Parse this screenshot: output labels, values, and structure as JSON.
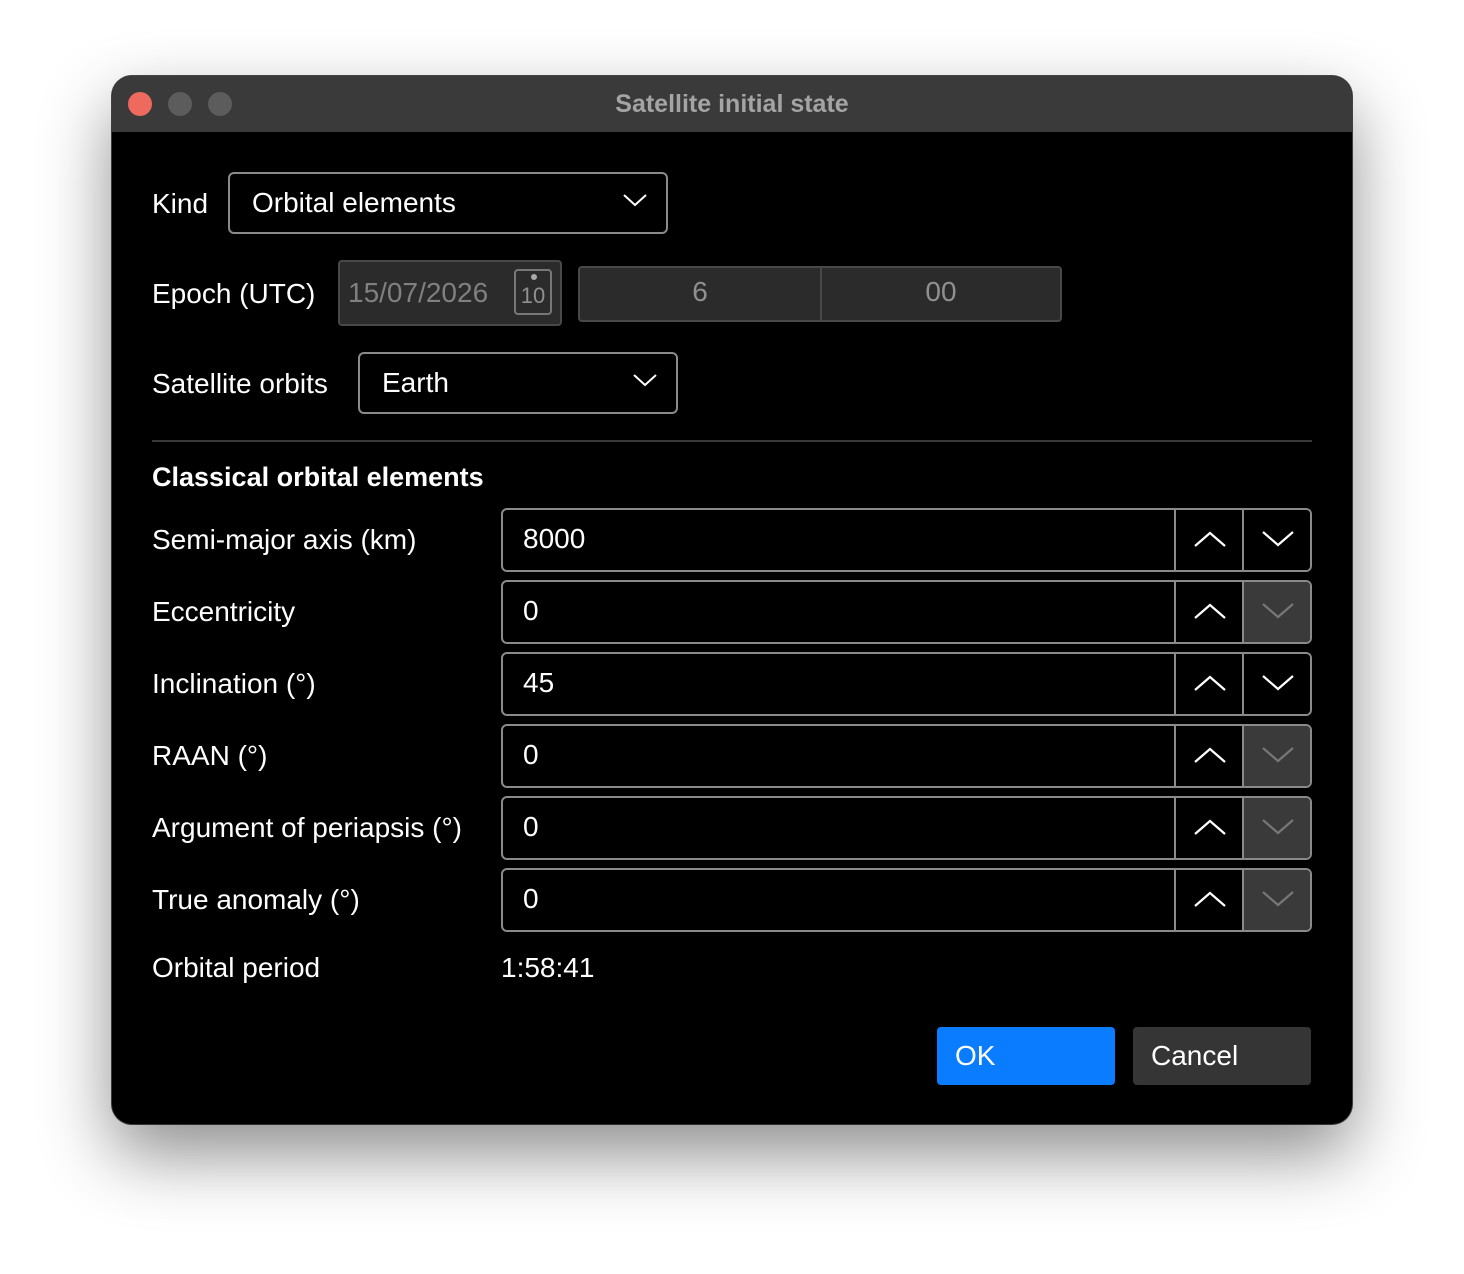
{
  "window": {
    "title": "Satellite initial state"
  },
  "kind": {
    "label": "Kind",
    "value": "Orbital elements"
  },
  "epoch": {
    "label": "Epoch (UTC)",
    "date": "15/07/2026",
    "calendar_day": "10",
    "hour": "6",
    "minute": "00"
  },
  "orbits": {
    "label": "Satellite orbits",
    "value": "Earth"
  },
  "section_title": "Classical orbital elements",
  "fields": [
    {
      "label": "Semi-major axis (km)",
      "value": "8000",
      "down_enabled": true
    },
    {
      "label": "Eccentricity",
      "value": "0",
      "down_enabled": false
    },
    {
      "label": "Inclination (°)",
      "value": "45",
      "down_enabled": true
    },
    {
      "label": "RAAN (°)",
      "value": "0",
      "down_enabled": false
    },
    {
      "label": "Argument of periapsis (°)",
      "value": "0",
      "down_enabled": false
    },
    {
      "label": "True anomaly (°)",
      "value": "0",
      "down_enabled": false
    }
  ],
  "period": {
    "label": "Orbital period",
    "value": "1:58:41"
  },
  "buttons": {
    "ok": "OK",
    "cancel": "Cancel"
  },
  "icons": {
    "dropdown": "chevron-down-icon",
    "calendar": "calendar-icon",
    "spin_up": "chevron-up-icon",
    "spin_down": "chevron-down-icon"
  },
  "colors": {
    "accent": "#0a7cff",
    "close": "#ee6a5e",
    "titlebar": "#3a3a3a",
    "background": "#000000"
  }
}
